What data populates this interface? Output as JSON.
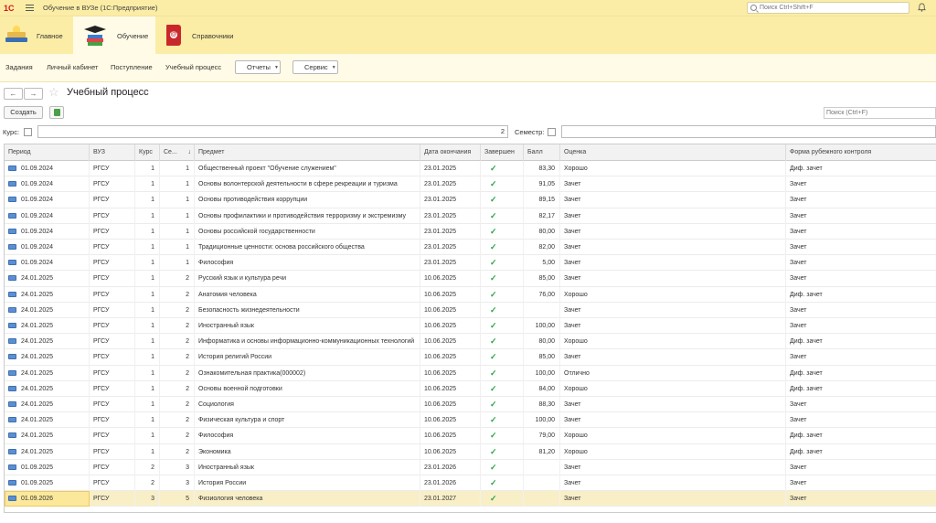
{
  "app": {
    "logo": "1С",
    "title": "Обучение в ВУЗе  (1С:Предприятие)",
    "search_placeholder": "Поиск Ctrl+Shift+F"
  },
  "sections": [
    {
      "label": "Главное",
      "icon": "desk-lamp-icon"
    },
    {
      "label": "Обучение",
      "icon": "graduation-books-icon",
      "active": true
    },
    {
      "label": "Справочники",
      "icon": "red-book-icon"
    }
  ],
  "function_panel": {
    "items": [
      "Задания",
      "Личный кабинет",
      "Поступление",
      "Учебный процесс"
    ],
    "reports_label": "Отчеты",
    "service_label": "Сервис"
  },
  "form": {
    "title": "Учебный процесс",
    "back_glyph": "←",
    "forward_glyph": "→",
    "create_label": "Создать",
    "search_placeholder": "Поиск (Ctrl+F)",
    "filter_course_label": "Курс:",
    "filter_course_value": "2",
    "filter_semester_label": "Семестр:",
    "filter_semester_value": ""
  },
  "table": {
    "columns": [
      "Период",
      "ВУЗ",
      "Курс",
      "Се...",
      "Предмет",
      "Дата окончания",
      "Завершен",
      "Балл",
      "Оценка",
      "Форма рубежного контроля"
    ],
    "sort_indicator": "↓",
    "done_glyph": "✓",
    "rows": [
      {
        "period": "01.09.2024",
        "vuz": "РГСУ",
        "kurs": "1",
        "sem": "1",
        "subject": "Общественный проект \"Обучение служением\"",
        "end": "23.01.2025",
        "done": true,
        "score": "83,30",
        "grade": "Хорошо",
        "form": "Диф. зачет"
      },
      {
        "period": "01.09.2024",
        "vuz": "РГСУ",
        "kurs": "1",
        "sem": "1",
        "subject": "Основы волонтерской деятельности в сфере рекреации и туризма",
        "end": "23.01.2025",
        "done": true,
        "score": "91,05",
        "grade": "Зачет",
        "form": "Зачет"
      },
      {
        "period": "01.09.2024",
        "vuz": "РГСУ",
        "kurs": "1",
        "sem": "1",
        "subject": "Основы противодействия коррупции",
        "end": "23.01.2025",
        "done": true,
        "score": "89,15",
        "grade": "Зачет",
        "form": "Зачет"
      },
      {
        "period": "01.09.2024",
        "vuz": "РГСУ",
        "kurs": "1",
        "sem": "1",
        "subject": "Основы профилактики и противодействия терроризму и экстремизму",
        "end": "23.01.2025",
        "done": true,
        "score": "82,17",
        "grade": "Зачет",
        "form": "Зачет"
      },
      {
        "period": "01.09.2024",
        "vuz": "РГСУ",
        "kurs": "1",
        "sem": "1",
        "subject": "Основы российской государственности",
        "end": "23.01.2025",
        "done": true,
        "score": "80,00",
        "grade": "Зачет",
        "form": "Зачет"
      },
      {
        "period": "01.09.2024",
        "vuz": "РГСУ",
        "kurs": "1",
        "sem": "1",
        "subject": "Традиционные ценности: основа российского общества",
        "end": "23.01.2025",
        "done": true,
        "score": "82,00",
        "grade": "Зачет",
        "form": "Зачет"
      },
      {
        "period": "01.09.2024",
        "vuz": "РГСУ",
        "kurs": "1",
        "sem": "1",
        "subject": "Философия",
        "end": "23.01.2025",
        "done": true,
        "score": "5,00",
        "grade": "Зачет",
        "form": "Зачет"
      },
      {
        "period": "24.01.2025",
        "vuz": "РГСУ",
        "kurs": "1",
        "sem": "2",
        "subject": "Русский язык и культура речи",
        "end": "10.06.2025",
        "done": true,
        "score": "85,00",
        "grade": "Зачет",
        "form": "Зачет"
      },
      {
        "period": "24.01.2025",
        "vuz": "РГСУ",
        "kurs": "1",
        "sem": "2",
        "subject": "Анатомия человека",
        "end": "10.06.2025",
        "done": true,
        "score": "76,00",
        "grade": "Хорошо",
        "form": "Диф. зачет"
      },
      {
        "period": "24.01.2025",
        "vuz": "РГСУ",
        "kurs": "1",
        "sem": "2",
        "subject": "Безопасность жизнедеятельности",
        "end": "10.06.2025",
        "done": true,
        "score": "",
        "grade": "Зачет",
        "form": "Зачет"
      },
      {
        "period": "24.01.2025",
        "vuz": "РГСУ",
        "kurs": "1",
        "sem": "2",
        "subject": "Иностранный язык",
        "end": "10.06.2025",
        "done": true,
        "score": "100,00",
        "grade": "Зачет",
        "form": "Зачет"
      },
      {
        "period": "24.01.2025",
        "vuz": "РГСУ",
        "kurs": "1",
        "sem": "2",
        "subject": "Информатика и основы информационно-коммуникационных технологий",
        "end": "10.06.2025",
        "done": true,
        "score": "80,00",
        "grade": "Хорошо",
        "form": "Диф. зачет"
      },
      {
        "period": "24.01.2025",
        "vuz": "РГСУ",
        "kurs": "1",
        "sem": "2",
        "subject": "История религий России",
        "end": "10.06.2025",
        "done": true,
        "score": "85,00",
        "grade": "Зачет",
        "form": "Зачет"
      },
      {
        "period": "24.01.2025",
        "vuz": "РГСУ",
        "kurs": "1",
        "sem": "2",
        "subject": "Ознакомительная практика(000002)",
        "end": "10.06.2025",
        "done": true,
        "score": "100,00",
        "grade": "Отлично",
        "form": "Диф. зачет"
      },
      {
        "period": "24.01.2025",
        "vuz": "РГСУ",
        "kurs": "1",
        "sem": "2",
        "subject": "Основы военной подготовки",
        "end": "10.06.2025",
        "done": true,
        "score": "84,00",
        "grade": "Хорошо",
        "form": "Диф. зачет"
      },
      {
        "period": "24.01.2025",
        "vuz": "РГСУ",
        "kurs": "1",
        "sem": "2",
        "subject": "Социология",
        "end": "10.06.2025",
        "done": true,
        "score": "88,30",
        "grade": "Зачет",
        "form": "Зачет"
      },
      {
        "period": "24.01.2025",
        "vuz": "РГСУ",
        "kurs": "1",
        "sem": "2",
        "subject": "Физическая культура и спорт",
        "end": "10.06.2025",
        "done": true,
        "score": "100,00",
        "grade": "Зачет",
        "form": "Зачет"
      },
      {
        "period": "24.01.2025",
        "vuz": "РГСУ",
        "kurs": "1",
        "sem": "2",
        "subject": "Философия",
        "end": "10.06.2025",
        "done": true,
        "score": "79,00",
        "grade": "Хорошо",
        "form": "Диф. зачет"
      },
      {
        "period": "24.01.2025",
        "vuz": "РГСУ",
        "kurs": "1",
        "sem": "2",
        "subject": "Экономика",
        "end": "10.06.2025",
        "done": true,
        "score": "81,20",
        "grade": "Хорошо",
        "form": "Диф. зачет"
      },
      {
        "period": "01.09.2025",
        "vuz": "РГСУ",
        "kurs": "2",
        "sem": "3",
        "subject": "Иностранный язык",
        "end": "23.01.2026",
        "done": true,
        "score": "",
        "grade": "Зачет",
        "form": "Зачет"
      },
      {
        "period": "01.09.2025",
        "vuz": "РГСУ",
        "kurs": "2",
        "sem": "3",
        "subject": "История России",
        "end": "23.01.2026",
        "done": true,
        "score": "",
        "grade": "Зачет",
        "form": "Зачет"
      },
      {
        "period": "01.09.2026",
        "vuz": "РГСУ",
        "kurs": "3",
        "sem": "5",
        "subject": "Физиология человека",
        "end": "23.01.2027",
        "done": true,
        "score": "",
        "grade": "Зачет",
        "form": "Зачет",
        "selected": true
      }
    ]
  },
  "colors": {
    "section_bg": "#fbeda5",
    "panel_bg": "#fffbe6",
    "selected_row": "#f9efc7",
    "check": "#2aa34a",
    "logo": "#d4141b"
  }
}
